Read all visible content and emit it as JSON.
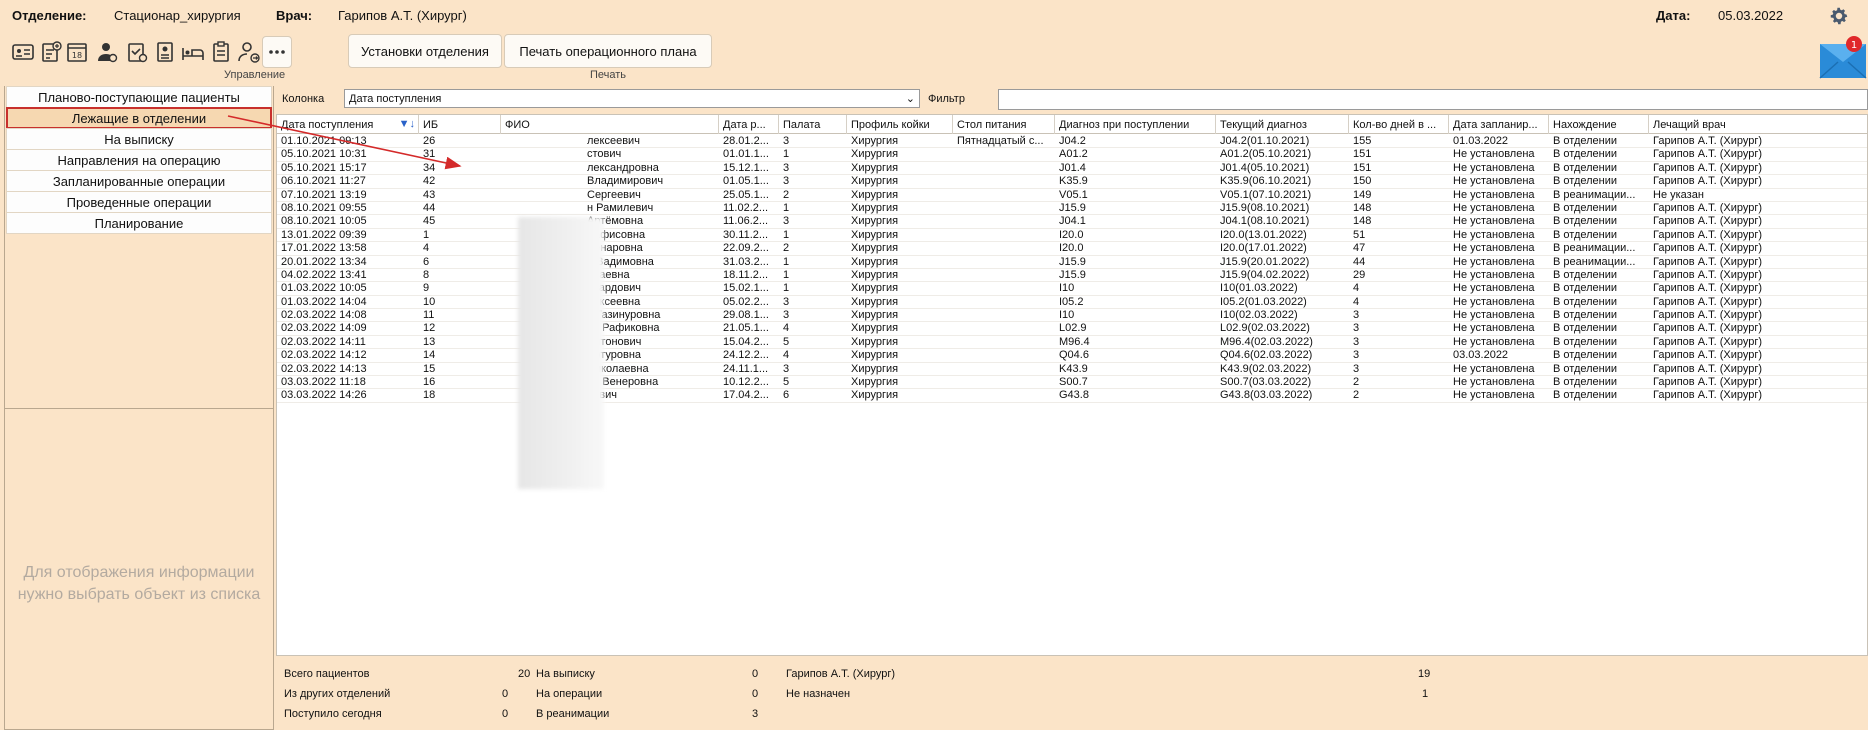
{
  "header": {
    "dept_label": "Отделение:",
    "dept_value": "Стационар_хирургия",
    "doctor_label": "Врач:",
    "doctor_value": "Гарипов А.Т. (Хирург)",
    "date_label": "Дата:",
    "date_value": "05.03.2022"
  },
  "toolbar": {
    "icons": [
      "id-card-icon",
      "clipboard-add-icon",
      "calendar-18-icon",
      "doctor-icon",
      "clipboard-check-icon",
      "badge-icon",
      "bed-icon",
      "clipboard-icon",
      "user-arrow-icon",
      "more-icon"
    ],
    "btn_settings": "Установки отделения",
    "btn_print": "Печать операционного плана",
    "group_manage": "Управление",
    "group_print": "Печать",
    "mail_badge": "1"
  },
  "nav": {
    "items": [
      "Планово-поступающие пациенты",
      "Лежащие в отделении",
      "На выписку",
      "Направления на операцию",
      "Запланированные операции",
      "Проведенные операции",
      "Планирование"
    ],
    "empty_message_1": "Для отображения информации",
    "empty_message_2": "нужно выбрать объект из списка"
  },
  "filter": {
    "column_label": "Колонка",
    "column_value": "Дата поступления",
    "filter_label": "Фильтр"
  },
  "table": {
    "headers": [
      "Дата поступления",
      "ИБ",
      "ФИО",
      "Дата р...",
      "Палата",
      "Профиль койки",
      "Стол питания",
      "Диагноз при поступлении",
      "Текущий диагноз",
      "Кол-во дней в ...",
      "Дата запланир...",
      "Нахождение",
      "Лечащий врач"
    ],
    "rows": [
      [
        "01.10.2021 09:13",
        "26",
        "лексеевич",
        "28.01.2...",
        "3",
        "Хирургия",
        "Пятнадцатый с...",
        "J04.2",
        "J04.2(01.10.2021)",
        "155",
        "01.03.2022",
        "В отделении",
        "Гарипов А.Т. (Хирург)"
      ],
      [
        "05.10.2021 10:31",
        "31",
        "стович",
        "01.01.1...",
        "1",
        "Хирургия",
        "",
        "A01.2",
        "A01.2(05.10.2021)",
        "151",
        "Не установлена",
        "В отделении",
        "Гарипов А.Т. (Хирург)"
      ],
      [
        "05.10.2021 15:17",
        "34",
        "лександровна",
        "15.12.1...",
        "3",
        "Хирургия",
        "",
        "J01.4",
        "J01.4(05.10.2021)",
        "151",
        "Не установлена",
        "В отделении",
        "Гарипов А.Т. (Хирург)"
      ],
      [
        "06.10.2021 11:27",
        "42",
        "Владимирович",
        "01.05.1...",
        "3",
        "Хирургия",
        "",
        "K35.9",
        "K35.9(06.10.2021)",
        "150",
        "Не установлена",
        "В отделении",
        "Гарипов А.Т. (Хирург)"
      ],
      [
        "07.10.2021 13:19",
        "43",
        "Сергеевич",
        "25.05.1...",
        "2",
        "Хирургия",
        "",
        "V05.1",
        "V05.1(07.10.2021)",
        "149",
        "Не установлена",
        "В реанимации...",
        "Не указан"
      ],
      [
        "08.10.2021 09:55",
        "44",
        "н Рамилевич",
        "11.02.2...",
        "1",
        "Хирургия",
        "",
        "J15.9",
        "J15.9(08.10.2021)",
        "148",
        "Не установлена",
        "В отделении",
        "Гарипов А.Т. (Хирург)"
      ],
      [
        "08.10.2021 10:05",
        "45",
        "Артёмовна",
        "11.06.2...",
        "3",
        "Хирургия",
        "",
        "J04.1",
        "J04.1(08.10.2021)",
        "148",
        "Не установлена",
        "В отделении",
        "Гарипов А.Т. (Хирург)"
      ],
      [
        "13.01.2022 09:39",
        "1",
        "Рафисовна",
        "30.11.2...",
        "1",
        "Хирургия",
        "",
        "I20.0",
        "I20.0(13.01.2022)",
        "51",
        "Не установлена",
        "В отделении",
        "Гарипов А.Т. (Хирург)"
      ],
      [
        "17.01.2022 13:58",
        "4",
        "Ленаровна",
        "22.09.2...",
        "2",
        "Хирургия",
        "",
        "I20.0",
        "I20.0(17.01.2022)",
        "47",
        "Не установлена",
        "В реанимации...",
        "Гарипов А.Т. (Хирург)"
      ],
      [
        "20.01.2022 13:34",
        "6",
        "а Вадимовна",
        "31.03.2...",
        "1",
        "Хирургия",
        "",
        "J15.9",
        "J15.9(20.01.2022)",
        "44",
        "Не установлена",
        "В реанимации...",
        "Гарипов А.Т. (Хирург)"
      ],
      [
        "04.02.2022 13:41",
        "8",
        "олаевна",
        "18.11.2...",
        "1",
        "Хирургия",
        "",
        "J15.9",
        "J15.9(04.02.2022)",
        "29",
        "Не установлена",
        "В отделении",
        "Гарипов А.Т. (Хирург)"
      ],
      [
        "01.03.2022 10:05",
        "9",
        "дуардович",
        "15.02.1...",
        "1",
        "Хирургия",
        "",
        "I10",
        "I10(01.03.2022)",
        "4",
        "Не установлена",
        "В отделении",
        "Гарипов А.Т. (Хирург)"
      ],
      [
        "01.03.2022 14:04",
        "10",
        "лексеевна",
        "05.02.2...",
        "3",
        "Хирургия",
        "",
        "I05.2",
        "I05.2(01.03.2022)",
        "4",
        "Не установлена",
        "В отделении",
        "Гарипов А.Т. (Хирург)"
      ],
      [
        "02.03.2022 14:08",
        "11",
        "а Газинуровна",
        "29.08.1...",
        "3",
        "Хирургия",
        "",
        "I10",
        "I10(02.03.2022)",
        "3",
        "Не установлена",
        "В отделении",
        "Гарипов А.Т. (Хирург)"
      ],
      [
        "02.03.2022 14:09",
        "12",
        "ия Рафиковна",
        "21.05.1...",
        "4",
        "Хирургия",
        "",
        "L02.9",
        "L02.9(02.03.2022)",
        "3",
        "Не установлена",
        "В отделении",
        "Гарипов А.Т. (Хирург)"
      ],
      [
        "02.03.2022 14:11",
        "13",
        "Антонович",
        "15.04.2...",
        "5",
        "Хирургия",
        "",
        "M96.4",
        "M96.4(02.03.2022)",
        "3",
        "Не установлена",
        "В отделении",
        "Гарипов А.Т. (Хирург)"
      ],
      [
        "02.03.2022 14:12",
        "14",
        "Артуровна",
        "24.12.2...",
        "4",
        "Хирургия",
        "",
        "Q04.6",
        "Q04.6(02.03.2022)",
        "3",
        "03.03.2022",
        "В отделении",
        "Гарипов А.Т. (Хирург)"
      ],
      [
        "02.03.2022 14:13",
        "15",
        "Николаевна",
        "24.11.1...",
        "3",
        "Хирургия",
        "",
        "K43.9",
        "K43.9(02.03.2022)",
        "3",
        "Не установлена",
        "В отделении",
        "Гарипов А.Т. (Хирург)"
      ],
      [
        "03.03.2022 11:18",
        "16",
        "ра Венеровна",
        "10.12.2...",
        "5",
        "Хирургия",
        "",
        "S00.7",
        "S00.7(03.03.2022)",
        "2",
        "Не установлена",
        "В отделении",
        "Гарипов А.Т. (Хирург)"
      ],
      [
        "03.03.2022 14:26",
        "18",
        "еевич",
        "17.04.2...",
        "6",
        "Хирургия",
        "",
        "G43.8",
        "G43.8(03.03.2022)",
        "2",
        "Не установлена",
        "В отделении",
        "Гарипов А.Т. (Хирург)"
      ]
    ]
  },
  "summary": {
    "total_label": "Всего пациентов",
    "total_value": "20",
    "other_label": "Из других отделений",
    "other_value": "0",
    "today_label": "Поступило сегодня",
    "today_value": "0",
    "discharge_label": "На выписку",
    "discharge_value": "0",
    "surgery_label": "На операции",
    "surgery_value": "0",
    "icu_label": "В реанимации",
    "icu_value": "3",
    "doc1_label": "Гарипов А.Т. (Хирург)",
    "doc1_value": "19",
    "doc2_label": "Не назначен",
    "doc2_value": "1"
  }
}
